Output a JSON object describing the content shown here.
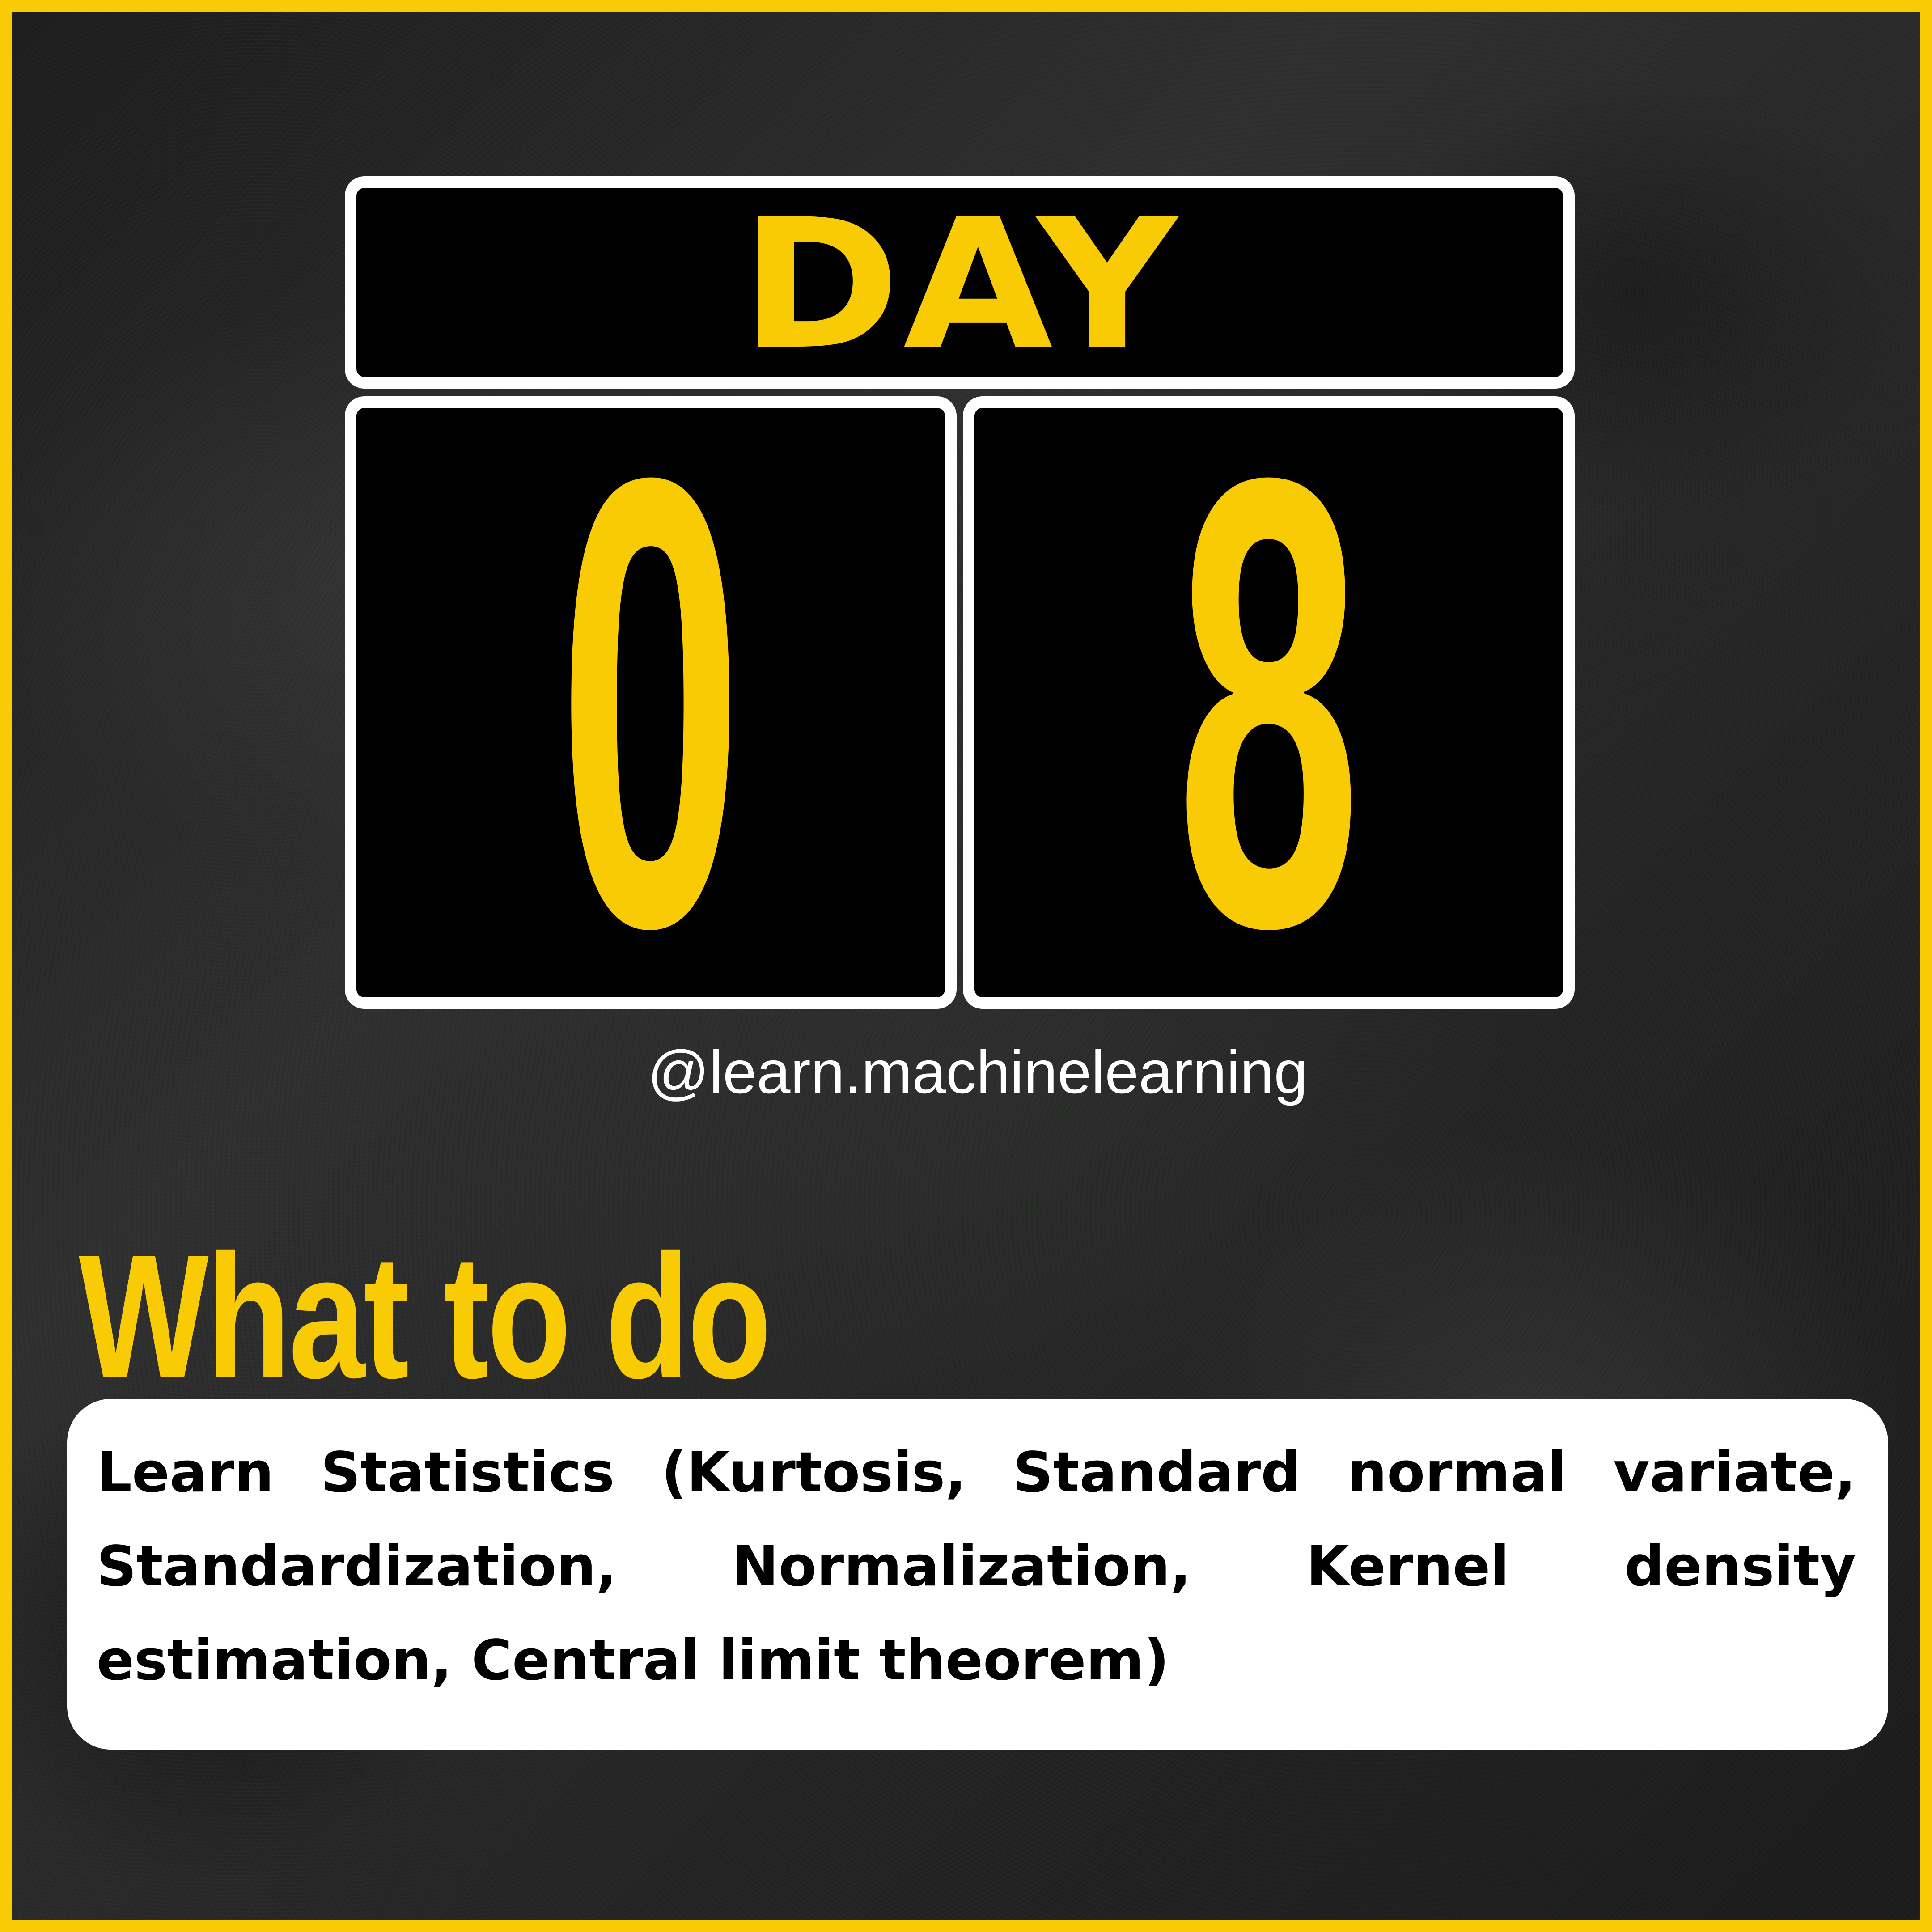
{
  "calendar": {
    "label": "DAY",
    "digit_1": "0",
    "digit_2": "8"
  },
  "handle": "@learn.machinelearning",
  "section": {
    "heading": "What to do",
    "body": "Learn Statistics (Kurtosis, Standard normal variate, Standardization, Normalization, Kernel density estimation, Central limit theorem)"
  },
  "colors": {
    "accent": "#f9cb05",
    "card": "#000000",
    "card_border": "#ffffff",
    "background": "#2a2b2a",
    "panel": "#ffffff",
    "panel_text": "#000000"
  }
}
